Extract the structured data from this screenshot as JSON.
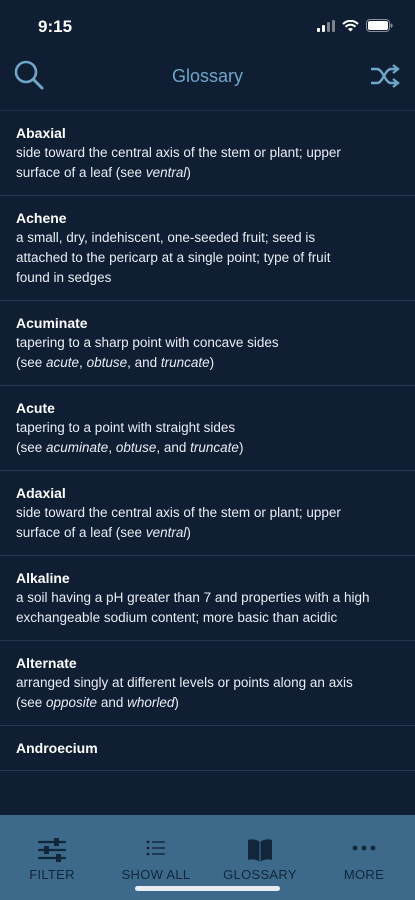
{
  "status": {
    "time": "9:15"
  },
  "header": {
    "title": "Glossary"
  },
  "entries": [
    {
      "term": "Abaxial",
      "def": [
        "side toward the central axis of the stem or plant; upper",
        "surface of a leaf (see ",
        "ventral",
        ")"
      ]
    },
    {
      "term": "Achene",
      "def": [
        "a small, dry, indehiscent, one-seeded fruit; seed is",
        "attached to the pericarp at a single point; type of fruit",
        "found in sedges"
      ]
    },
    {
      "term": "Acuminate",
      "def": [
        "tapering to a sharp point with concave sides",
        "(see ",
        "acute",
        ", ",
        "obtuse",
        ", and ",
        "truncate",
        ")"
      ]
    },
    {
      "term": "Acute",
      "def": [
        "tapering to a point with straight sides",
        "(see ",
        "acuminate",
        ", ",
        "obtuse",
        ", and ",
        "truncate",
        ")"
      ]
    },
    {
      "term": "Adaxial",
      "def": [
        "side toward the central axis of the stem or plant; upper",
        "surface of a leaf (see ",
        "ventral",
        ")"
      ]
    },
    {
      "term": "Alkaline",
      "def": [
        "a soil having a pH greater than 7 and properties with a high",
        "exchangeable sodium content; more basic than acidic"
      ]
    },
    {
      "term": "Alternate",
      "def": [
        "arranged singly at different levels or points along an axis",
        "(see ",
        "opposite",
        " and ",
        "whorled",
        ")"
      ]
    },
    {
      "term": "Androecium",
      "def": []
    }
  ],
  "tabs": [
    {
      "label": "FILTER",
      "icon": "sliders-icon"
    },
    {
      "label": "SHOW ALL",
      "icon": "list-icon"
    },
    {
      "label": "GLOSSARY",
      "icon": "book-icon"
    },
    {
      "label": "MORE",
      "icon": "more-dots-icon"
    }
  ],
  "colors": {
    "background": "#0f1e33",
    "accent": "#6fa6c8",
    "tabbar": "#3d6a8a"
  }
}
